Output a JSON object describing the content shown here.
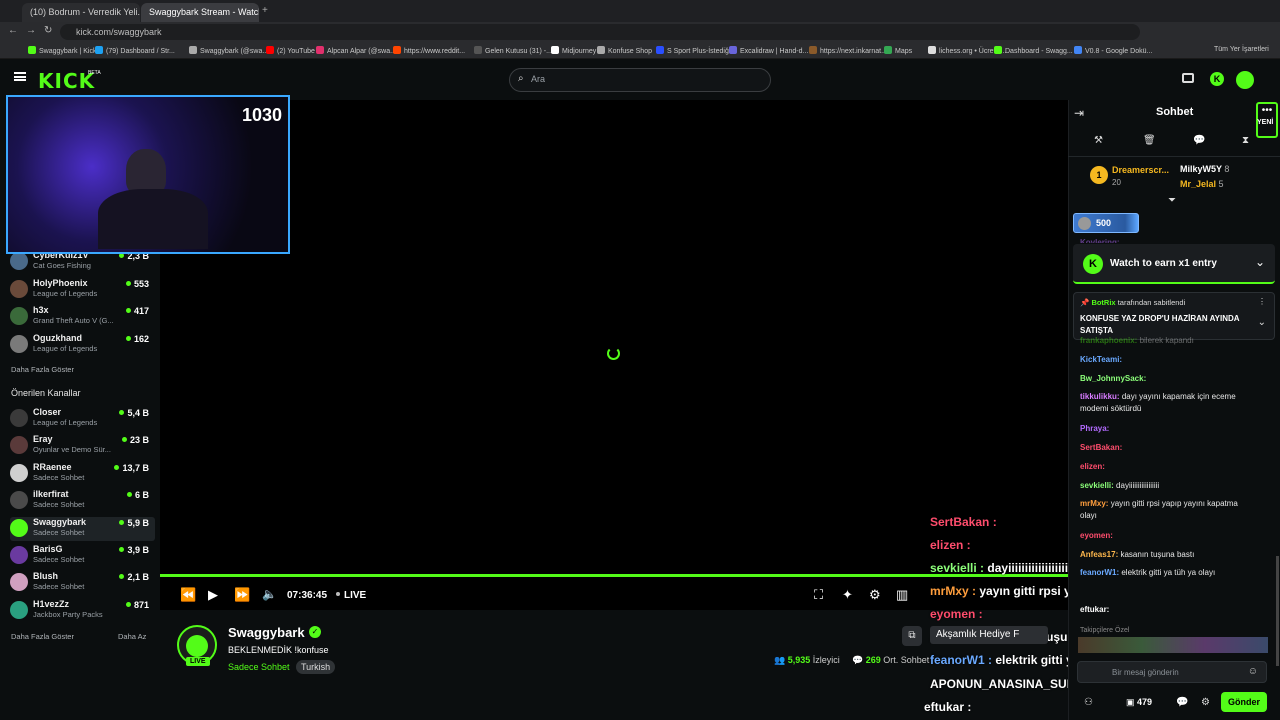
{
  "browser": {
    "tabs": [
      {
        "label": "(10) Bodrum - Verredik Yeli..."
      },
      {
        "label": "Swaggybark Stream - Watch L..."
      }
    ],
    "url": "kick.com/swaggybark",
    "bookmarks": [
      "Swaggybark | Kick",
      "(79) Dashboard / Str...",
      "Swaggybark (@swa...",
      "(2) YouTube",
      "Alpcan Alpar (@swa...",
      "https://www.reddit...",
      "Gelen Kutusu (31) -...",
      "Midjourney",
      "Konfuse Shop",
      "S Sport Plus-İstediği...",
      "Excalidraw | Hand-d...",
      "https://next.inkarnat...",
      "Maps",
      "lichess.org • Ücretsi...",
      "Dashboard - Swagg...",
      "V0.8 - Google Dokü..."
    ],
    "all_bookmarks": "Tüm Yer İşaretleri"
  },
  "header": {
    "logo": "KICK",
    "logo_badge": "BETA",
    "search_placeholder": "Ara"
  },
  "webcam": {
    "counter": "1030"
  },
  "sidebar": {
    "followed": [
      {
        "name": "CyberKuiz1V",
        "game": "Cat Goes Fishing",
        "viewers": "2,3 B"
      },
      {
        "name": "HolyPhoenix",
        "game": "League of Legends",
        "viewers": "553"
      },
      {
        "name": "h3x",
        "game": "Grand Theft Auto V (G...",
        "viewers": "417"
      },
      {
        "name": "Oguzkhand",
        "game": "League of Legends",
        "viewers": "162"
      }
    ],
    "show_more": "Daha Fazla Göster",
    "recommended_title": "Önerilen Kanallar",
    "recommended": [
      {
        "name": "Closer",
        "game": "League of Legends",
        "viewers": "5,4 B"
      },
      {
        "name": "Eray",
        "game": "Oyunlar ve Demo Sür...",
        "viewers": "23 B"
      },
      {
        "name": "RRaenee",
        "game": "Sadece Sohbet",
        "viewers": "13,7 B"
      },
      {
        "name": "ilkerfirat",
        "game": "Sadece Sohbet",
        "viewers": "6 B"
      },
      {
        "name": "Swaggybark",
        "game": "Sadece Sohbet",
        "viewers": "5,9 B"
      },
      {
        "name": "BarisG",
        "game": "Sadece Sohbet",
        "viewers": "3,9 B"
      },
      {
        "name": "Blush",
        "game": "Sadece Sohbet",
        "viewers": "2,1 B"
      },
      {
        "name": "H1vezZz",
        "game": "Jackbox Party Packs",
        "viewers": "871"
      }
    ],
    "show_more_2": "Daha Fazla Göster",
    "show_less": "Daha Az"
  },
  "player": {
    "time": "07:36:45",
    "live_label": "LIVE",
    "progress": 1.0
  },
  "stream_overlay_chat": [
    {
      "user": "SertBakan :",
      "text": ""
    },
    {
      "user": "elizen :",
      "text": ""
    },
    {
      "user": "sevkielli :",
      "text": "dayiiiiiiiiiiiiiiiiiiii"
    },
    {
      "user": "mrMxy :",
      "text": "yayın gitti rpsi yapıp yayını kapatma olayı"
    },
    {
      "user": "eyomen :",
      "text": ""
    },
    {
      "user": "Anfeas17 :",
      "text": "kasanın tuşuna bastı"
    },
    {
      "user": "feanorW1 :",
      "text": "elektrik gitti ya tüh ya olayı"
    },
    {
      "user": "APONUN_ANASINA_SUPLEXATAN :",
      "text": ""
    },
    {
      "user": "eftukar :",
      "text": ""
    }
  ],
  "overlay_extra": {
    "box_label": "Akşamlık Hediye F"
  },
  "stream_info": {
    "channel": "Swaggybark",
    "live_badge": "LIVE",
    "title": "BEKLENMEDİK !konfuse",
    "category": "Sadece Sohbet",
    "language": "Turkish",
    "viewers": "5,935",
    "viewers_label": "İzleyici",
    "avg": "269",
    "avg_label": "Ort. Sohbet"
  },
  "chat": {
    "title": "Sohbet",
    "new_label": "YENİ",
    "leaderboard": [
      {
        "rank": "1",
        "name": "Dreamerscr...",
        "score": "20"
      },
      {
        "name": "MilkyW5Y",
        "score": "8"
      },
      {
        "name": "Mr_Jelal",
        "score": "5"
      }
    ],
    "gift_amount": "500",
    "watch_earn": "Watch to earn x1 entry",
    "pinned_by": "BotRix",
    "pinned_suffix": "tarafından sabitlendi",
    "pinned_text": "KONFUSE YAZ DROP'U HAZİRAN AYINDA SATIŞTA",
    "messages": [
      {
        "user": "Kovlering:",
        "text": "",
        "color": "#b36bff"
      },
      {
        "user": "frankaphoenix:",
        "text": "bilerek kapandı",
        "color": "#53fc18"
      },
      {
        "user": "KickTeami:",
        "text": "",
        "color": "#6aa9ff"
      },
      {
        "user": "Bw_JohnnySack:",
        "text": "",
        "color": "#8cff7a"
      },
      {
        "user": "tikkulikku:",
        "text": "dayı yayını kapamak için eceme modemi söktürdü",
        "color": "#d77bff"
      },
      {
        "user": "Phraya:",
        "text": "",
        "color": "#b36bff"
      },
      {
        "user": "SertBakan:",
        "text": "",
        "color": "#ff4d6d"
      },
      {
        "user": "elizen:",
        "text": "",
        "color": "#ff4d6d"
      },
      {
        "user": "sevkielli:",
        "text": "dayiiiiiiiiiiiiiiiii",
        "color": "#8cff7a"
      },
      {
        "user": "mrMxy:",
        "text": "yayın gitti rpsi yapıp yayını kapatma olayı",
        "color": "#ff9e3d"
      },
      {
        "user": "eyomen:",
        "text": "",
        "color": "#ff4d6d"
      },
      {
        "user": "Anfeas17:",
        "text": "kasanın tuşuna bastı",
        "color": "#ffb84d"
      },
      {
        "user": "feanorW1:",
        "text": "elektrik gitti ya tüh ya olayı",
        "color": "#6aa9ff"
      },
      {
        "user": "eftukar:",
        "text": "",
        "color": "#ffffff"
      }
    ],
    "follower_emotes": "Takipçilere Özel",
    "input_placeholder": "Bir mesaj gönderin",
    "points": "479",
    "send_label": "Gönder"
  },
  "colors": {
    "accent": "#53fc18",
    "bg": "#0b0e0f"
  }
}
